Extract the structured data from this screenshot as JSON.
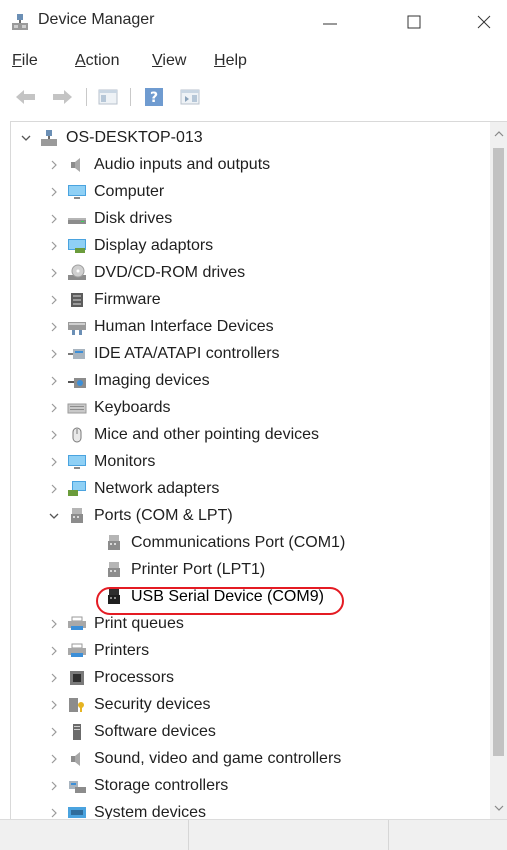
{
  "window": {
    "title": "Device Manager"
  },
  "menu": {
    "file": {
      "u": "F",
      "rest": "ile"
    },
    "action": {
      "u": "A",
      "rest": "ction"
    },
    "view": {
      "u": "V",
      "rest": "iew"
    },
    "help": {
      "u": "H",
      "rest": "elp"
    }
  },
  "tree": {
    "root": "OS-DESKTOP-013",
    "categories": [
      {
        "label": "Audio inputs and outputs",
        "icon": "speaker-icon"
      },
      {
        "label": "Computer",
        "icon": "monitor-icon"
      },
      {
        "label": "Disk drives",
        "icon": "disk-drive-icon"
      },
      {
        "label": "Display adaptors",
        "icon": "display-adapter-icon"
      },
      {
        "label": "DVD/CD-ROM drives",
        "icon": "dvd-drive-icon"
      },
      {
        "label": "Firmware",
        "icon": "firmware-chip-icon"
      },
      {
        "label": "Human Interface Devices",
        "icon": "hid-icon"
      },
      {
        "label": "IDE ATA/ATAPI controllers",
        "icon": "ide-controller-icon"
      },
      {
        "label": "Imaging devices",
        "icon": "camera-icon"
      },
      {
        "label": "Keyboards",
        "icon": "keyboard-icon"
      },
      {
        "label": "Mice and other pointing devices",
        "icon": "mouse-icon"
      },
      {
        "label": "Monitors",
        "icon": "monitor-icon"
      },
      {
        "label": "Network adapters",
        "icon": "network-adapter-icon"
      },
      {
        "label": "Ports (COM & LPT)",
        "icon": "port-icon"
      }
    ],
    "ports_children": [
      {
        "label": "Communications Port (COM1)",
        "icon": "port-icon"
      },
      {
        "label": "Printer Port (LPT1)",
        "icon": "port-icon"
      },
      {
        "label": "USB Serial Device (COM9)",
        "icon": "usb-serial-port-icon"
      }
    ],
    "more_categories": [
      {
        "label": "Print queues",
        "icon": "printer-icon"
      },
      {
        "label": "Printers",
        "icon": "printer-icon"
      },
      {
        "label": "Processors",
        "icon": "processor-icon"
      },
      {
        "label": "Security devices",
        "icon": "security-device-icon"
      },
      {
        "label": "Software devices",
        "icon": "software-device-icon"
      },
      {
        "label": "Sound, video and game controllers",
        "icon": "speaker-icon"
      },
      {
        "label": "Storage controllers",
        "icon": "storage-controller-icon"
      },
      {
        "label": "System devices",
        "icon": "system-device-icon"
      }
    ]
  },
  "colors": {
    "highlight_ring": "#e41b23",
    "accent": "#3c8fd8"
  }
}
